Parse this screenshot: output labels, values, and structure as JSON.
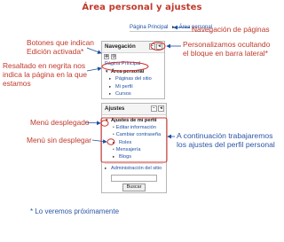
{
  "page": {
    "title": "Área personal y ajustes"
  },
  "breadcrumb": {
    "home": "Página Principal",
    "separator": "►",
    "current": "Área personal"
  },
  "annotations": {
    "nav_pages": "Navegación de páginas",
    "edit_buttons_line1": "Botones que indican",
    "edit_buttons_line2": "Edición activada*",
    "personalize_line1": "Personalizamos ocultando",
    "personalize_line2": "el bloque en barra lateral*",
    "bold_line1": "Resaltado en negrita nos",
    "bold_line2": "indica la página en la que",
    "bold_line3": "estamos",
    "dropdown_menu": "Menú desplegado",
    "no_dropdown_menu": "Menú sin desplegar",
    "profile_settings_line1": "A continuación trabajaremos",
    "profile_settings_line2": "los ajustes del perfil personal",
    "footnote": "* Lo veremos próximamente"
  },
  "navigation_block": {
    "title": "Navegación",
    "items": [
      {
        "label": "Página Principal",
        "bold": false,
        "indent": 0
      },
      {
        "label": "Área personal",
        "bold": true,
        "indent": 0
      },
      {
        "label": "Páginas del sitio",
        "bold": false,
        "indent": 1
      },
      {
        "label": "Mi perfil",
        "bold": false,
        "indent": 1
      },
      {
        "label": "Cursos",
        "bold": false,
        "indent": 1
      }
    ]
  },
  "settings_block": {
    "title": "Ajustes",
    "profile_header": "Ajustes de mi perfil",
    "profile_items": [
      "Editar información",
      "Cambiar contraseña"
    ],
    "collapsed_items": [
      "Roles"
    ],
    "other_items": [
      "Mensajería",
      "Blogs"
    ],
    "site_admin": "Administración del sitio",
    "search_button": "Buscar",
    "search_value": ""
  },
  "colors": {
    "annotation_red": "#c0392b",
    "annotation_blue": "#2e56a6",
    "link_blue": "#1f4fa3"
  }
}
